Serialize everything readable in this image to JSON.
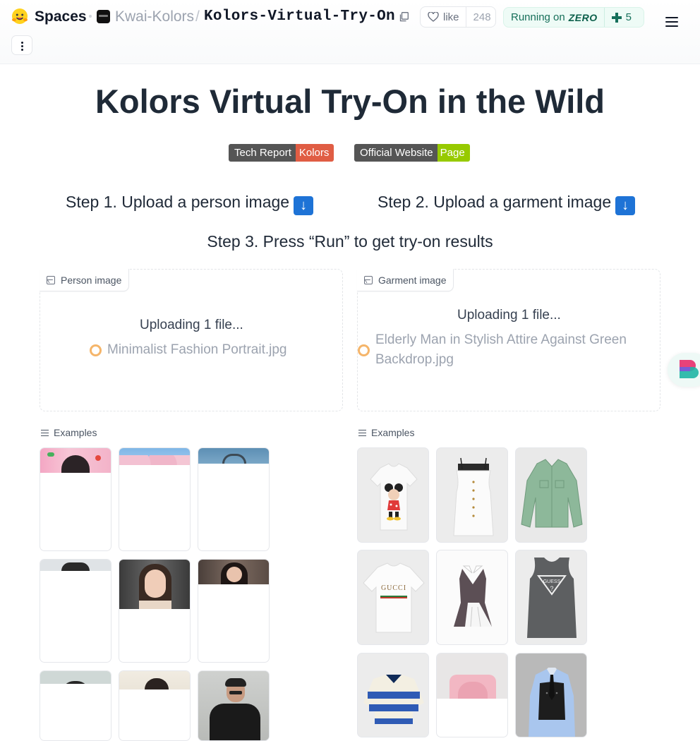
{
  "header": {
    "spaces_label": "Spaces",
    "org": "Kwai-Kolors",
    "separator": "/",
    "repo": "Kolors-Virtual-Try-On",
    "like_label": "like",
    "like_count": "248",
    "running_label": "Running on",
    "running_hw": "ZERO",
    "running_count": "5"
  },
  "app": {
    "title": "Kolors Virtual Try-On in the Wild",
    "badges": [
      {
        "left": "Tech Report",
        "right": "Kolors",
        "right_color": "#e05d44"
      },
      {
        "left": "Official Website",
        "right": "Page",
        "right_color": "#97ca00"
      }
    ],
    "step1": "Step 1. Upload a person image",
    "step2": "Step 2. Upload a garment image",
    "step3": "Step 3. Press “Run” to get try-on results",
    "step_arrow": "↓"
  },
  "person_panel": {
    "label": "Person image",
    "status": "Uploading 1 file...",
    "file": "Minimalist Fashion Portrait.jpg"
  },
  "garment_panel": {
    "label": "Garment image",
    "status": "Uploading 1 file...",
    "file_line1": "Elderly Man in Stylish Attire Against Green",
    "file_line2": "Backdrop.jpg"
  },
  "examples": {
    "person_label": "Examples",
    "garment_label": "Examples"
  },
  "colors": {
    "accent_blue": "#1e73d6",
    "running_green": "#166f59",
    "spinner_orange": "#f5b56a"
  }
}
